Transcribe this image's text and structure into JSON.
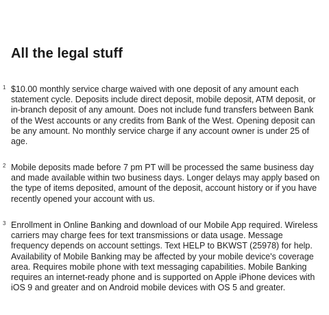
{
  "page": {
    "title": "All the legal stuff"
  },
  "footnotes": [
    {
      "number": "1",
      "text": "$10.00 monthly service charge waived with one deposit of any amount each statement cycle. Deposits include direct deposit, mobile deposit, ATM deposit, or in-branch deposit of any amount. Does not include fund transfers between Bank of the West accounts or any credits from Bank of the West. Opening deposit can be any amount. No monthly service charge if any account owner is under 25 of age."
    },
    {
      "number": "2",
      "text": "Mobile deposits made before 7 pm PT will be processed the same business day and made available within two business days. Longer delays may apply based on the type of items deposited, amount of the deposit, account history or if you have recently opened your account with us."
    },
    {
      "number": "3",
      "text": "Enrollment in Online Banking and download of our Mobile App required. Wireless carriers may charge fees for text transmissions or data usage. Message frequency depends on account settings. Text HELP to BKWST (25978) for help. Availability of Mobile Banking may be affected by your mobile device's coverage area. Requires mobile phone with text messaging capabilities. Mobile Banking requires an internet-ready phone and is supported on Apple iPhone devices with iOS 9 and greater and on Android mobile devices with OS 5 and greater."
    }
  ]
}
